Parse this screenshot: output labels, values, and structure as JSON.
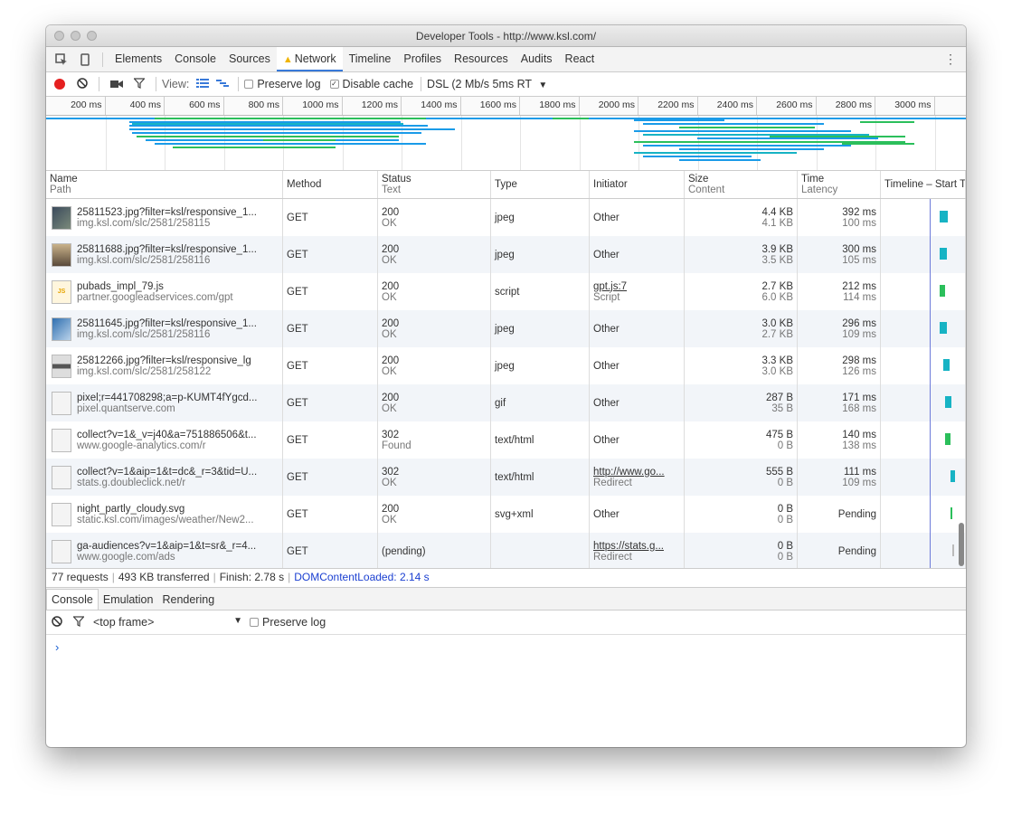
{
  "window": {
    "title": "Developer Tools - http://www.ksl.com/"
  },
  "tabs": [
    {
      "label": "Elements"
    },
    {
      "label": "Console"
    },
    {
      "label": "Sources"
    },
    {
      "label": "Network",
      "warning": true,
      "active": true
    },
    {
      "label": "Timeline"
    },
    {
      "label": "Profiles"
    },
    {
      "label": "Resources"
    },
    {
      "label": "Audits"
    },
    {
      "label": "React"
    }
  ],
  "toolbar": {
    "view_label": "View:",
    "preserve_log": {
      "label": "Preserve log",
      "checked": false
    },
    "disable_cache": {
      "label": "Disable cache",
      "checked": true
    },
    "throttle": "DSL (2 Mb/s 5ms RT"
  },
  "ruler": [
    "200 ms",
    "400 ms",
    "600 ms",
    "800 ms",
    "1000 ms",
    "1200 ms",
    "1400 ms",
    "1600 ms",
    "1800 ms",
    "2000 ms",
    "2200 ms",
    "2400 ms",
    "2600 ms",
    "2800 ms",
    "3000 ms"
  ],
  "columns": {
    "name": {
      "top": "Name",
      "sub": "Path"
    },
    "method": {
      "top": "Method"
    },
    "status": {
      "top": "Status",
      "sub": "Text"
    },
    "type": {
      "top": "Type"
    },
    "initiator": {
      "top": "Initiator"
    },
    "size": {
      "top": "Size",
      "sub": "Content"
    },
    "time": {
      "top": "Time",
      "sub": "Latency"
    },
    "timeline": {
      "top": "Timeline – Start Time"
    }
  },
  "requests": [
    {
      "name": "25811523.jpg?filter=ksl/responsive_1...",
      "path": "img.ksl.com/slc/2581/258115",
      "method": "GET",
      "status": "200",
      "status_text": "OK",
      "type": "jpeg",
      "initiator": "Other",
      "initiator_sub": "",
      "size": "4.4 KB",
      "content": "4.1 KB",
      "time": "392 ms",
      "latency": "100 ms",
      "thumb": "img-dark"
    },
    {
      "name": "25811688.jpg?filter=ksl/responsive_1...",
      "path": "img.ksl.com/slc/2581/258116",
      "method": "GET",
      "status": "200",
      "status_text": "OK",
      "type": "jpeg",
      "initiator": "Other",
      "initiator_sub": "",
      "size": "3.9 KB",
      "content": "3.5 KB",
      "time": "300 ms",
      "latency": "105 ms",
      "thumb": "img-sign"
    },
    {
      "name": "pubads_impl_79.js",
      "path": "partner.googleadservices.com/gpt",
      "method": "GET",
      "status": "200",
      "status_text": "OK",
      "type": "script",
      "initiator": "gpt.js:7",
      "initiator_sub": "Script",
      "size": "2.7 KB",
      "content": "6.0 KB",
      "time": "212 ms",
      "latency": "114 ms",
      "thumb": "js"
    },
    {
      "name": "25811645.jpg?filter=ksl/responsive_1...",
      "path": "img.ksl.com/slc/2581/258116",
      "method": "GET",
      "status": "200",
      "status_text": "OK",
      "type": "jpeg",
      "initiator": "Other",
      "initiator_sub": "",
      "size": "3.0 KB",
      "content": "2.7 KB",
      "time": "296 ms",
      "latency": "109 ms",
      "thumb": "img-blue"
    },
    {
      "name": "25812266.jpg?filter=ksl/responsive_lg",
      "path": "img.ksl.com/slc/2581/258122",
      "method": "GET",
      "status": "200",
      "status_text": "OK",
      "type": "jpeg",
      "initiator": "Other",
      "initiator_sub": "",
      "size": "3.3 KB",
      "content": "3.0 KB",
      "time": "298 ms",
      "latency": "126 ms",
      "thumb": "img-car"
    },
    {
      "name": "pixel;r=441708298;a=p-KUMT4fYgcd...",
      "path": "pixel.quantserve.com",
      "method": "GET",
      "status": "200",
      "status_text": "OK",
      "type": "gif",
      "initiator": "Other",
      "initiator_sub": "",
      "size": "287 B",
      "content": "35 B",
      "time": "171 ms",
      "latency": "168 ms",
      "thumb": "blank"
    },
    {
      "name": "collect?v=1&_v=j40&a=751886506&t...",
      "path": "www.google-analytics.com/r",
      "method": "GET",
      "status": "302",
      "status_text": "Found",
      "type": "text/html",
      "initiator": "Other",
      "initiator_sub": "",
      "size": "475 B",
      "content": "0 B",
      "time": "140 ms",
      "latency": "138 ms",
      "thumb": "blank"
    },
    {
      "name": "collect?v=1&aip=1&t=dc&_r=3&tid=U...",
      "path": "stats.g.doubleclick.net/r",
      "method": "GET",
      "status": "302",
      "status_text": "OK",
      "type": "text/html",
      "initiator": "http://www.go...",
      "initiator_sub": "Redirect",
      "size": "555 B",
      "content": "0 B",
      "time": "111 ms",
      "latency": "109 ms",
      "thumb": "blank"
    },
    {
      "name": "night_partly_cloudy.svg",
      "path": "static.ksl.com/images/weather/New2...",
      "method": "GET",
      "status": "200",
      "status_text": "OK",
      "type": "svg+xml",
      "initiator": "Other",
      "initiator_sub": "",
      "size": "0 B",
      "content": "0 B",
      "time": "Pending",
      "latency": "",
      "thumb": "blank"
    },
    {
      "name": "ga-audiences?v=1&aip=1&t=sr&_r=4...",
      "path": "www.google.com/ads",
      "method": "GET",
      "status": "(pending)",
      "status_text": "",
      "type": "",
      "initiator": "https://stats.g...",
      "initiator_sub": "Redirect",
      "size": "0 B",
      "content": "0 B",
      "time": "Pending",
      "latency": "",
      "thumb": "blank"
    }
  ],
  "summary": {
    "requests": "77 requests",
    "transferred": "493 KB transferred",
    "finish": "Finish: 2.78 s",
    "dcl": "DOMContentLoaded: 2.14 s"
  },
  "drawer": {
    "tabs": [
      "Console",
      "Emulation",
      "Rendering"
    ],
    "frame": "<top frame>",
    "preserve_log": "Preserve log",
    "prompt": "›"
  },
  "colors": {
    "accent": "#3879d9",
    "record": "#e52020",
    "bar_blue": "#1a9be8",
    "bar_green": "#2bbf5b",
    "bar_teal": "#17b3c4",
    "dcl_line": "#6d7bd9"
  },
  "icons": [
    "record-icon",
    "clear-icon",
    "camera-icon",
    "filter-icon",
    "large-rows-icon",
    "overview-icon",
    "inspect-icon",
    "device-icon",
    "more-icon"
  ]
}
